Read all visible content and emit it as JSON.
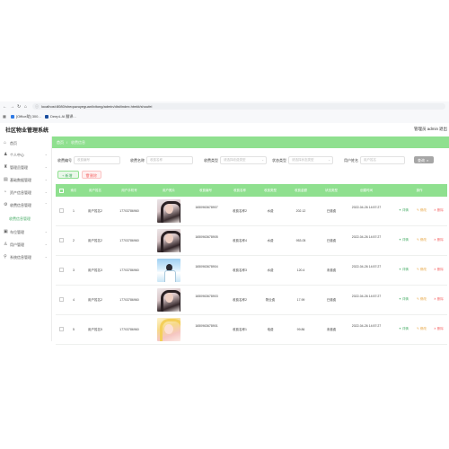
{
  "browser": {
    "url": "localhost:8080/shequwuyeguanlixitong/admin/dist/index.html#/shoufei",
    "bookmarks": [
      "[Office助] 300...",
      "DeepL AI 翻译..."
    ]
  },
  "app": {
    "title": "社区物业管理系统",
    "user_info": "管理员 admin",
    "logout": "退出"
  },
  "sidebar": {
    "items": [
      {
        "label": "首页"
      },
      {
        "label": "个人中心"
      },
      {
        "label": "管理员管理"
      },
      {
        "label": "基础数据管理"
      },
      {
        "label": "资产信息管理"
      },
      {
        "label": "收费信息管理"
      },
      {
        "label": "车位管理"
      },
      {
        "label": "用户管理"
      },
      {
        "label": "系统信息管理"
      }
    ],
    "active_sub": "收费信息管理"
  },
  "breadcrumb": {
    "home": "首页",
    "separator": "/",
    "current": "收费信息"
  },
  "search": {
    "fields": [
      {
        "label": "收费编号",
        "placeholder": "收费编号"
      },
      {
        "label": "收费名称",
        "placeholder": "收费名称"
      },
      {
        "label": "收费类型",
        "placeholder": "请选择收费类型"
      },
      {
        "label": "状态类型",
        "placeholder": "请选择状态类型"
      },
      {
        "label": "用户姓名",
        "placeholder": "用户姓名"
      }
    ],
    "button": "查询"
  },
  "actions": {
    "add": "+ 新增",
    "delete": "删除"
  },
  "table": {
    "headers": [
      "索引",
      "用户姓名",
      "用户手机号",
      "用户照片",
      "收费编号",
      "收费名称",
      "收费类型",
      "收费金额",
      "状态类型",
      "创建时间",
      "操作"
    ],
    "rows": [
      {
        "index": "1",
        "name": "用户姓名2",
        "phone": "17703786960",
        "fee_no": "1650963678907",
        "fee_name": "收费名称2",
        "fee_type": "水费",
        "amount": "202.12",
        "status": "已缴费",
        "time": "2022-04-26 14:57:27"
      },
      {
        "index": "2",
        "name": "用户姓名2",
        "phone": "17703786960",
        "fee_no": "1650963678905",
        "fee_name": "收费名称4",
        "fee_type": "水费",
        "amount": "953.05",
        "status": "已缴费",
        "time": "2022-04-26 14:57:27"
      },
      {
        "index": "3",
        "name": "用户姓名3",
        "phone": "17703786960",
        "fee_no": "1650963678904",
        "fee_name": "收费名称3",
        "fee_type": "水费",
        "amount": "120.4",
        "status": "未缴费",
        "time": "2022-04-26 14:57:27"
      },
      {
        "index": "4",
        "name": "用户姓名2",
        "phone": "17703786960",
        "fee_no": "1650963678903",
        "fee_name": "收费名称2",
        "fee_type": "物业费",
        "amount": "17.99",
        "status": "已缴费",
        "time": "2022-04-26 14:57:27"
      },
      {
        "index": "5",
        "name": "用户姓名5",
        "phone": "17703786960",
        "fee_no": "1650963678901",
        "fee_name": "收费名称1",
        "fee_type": "电费",
        "amount": "99.86",
        "status": "未缴费",
        "time": "2022-04-26 14:57:27"
      }
    ],
    "op_labels": {
      "view": "详情",
      "edit": "修改",
      "delete": "删除"
    }
  },
  "colors": {
    "accent_green": "#8fe08f",
    "view": "#4cae6a",
    "edit": "#e6a23c",
    "delete": "#f56c6c"
  }
}
